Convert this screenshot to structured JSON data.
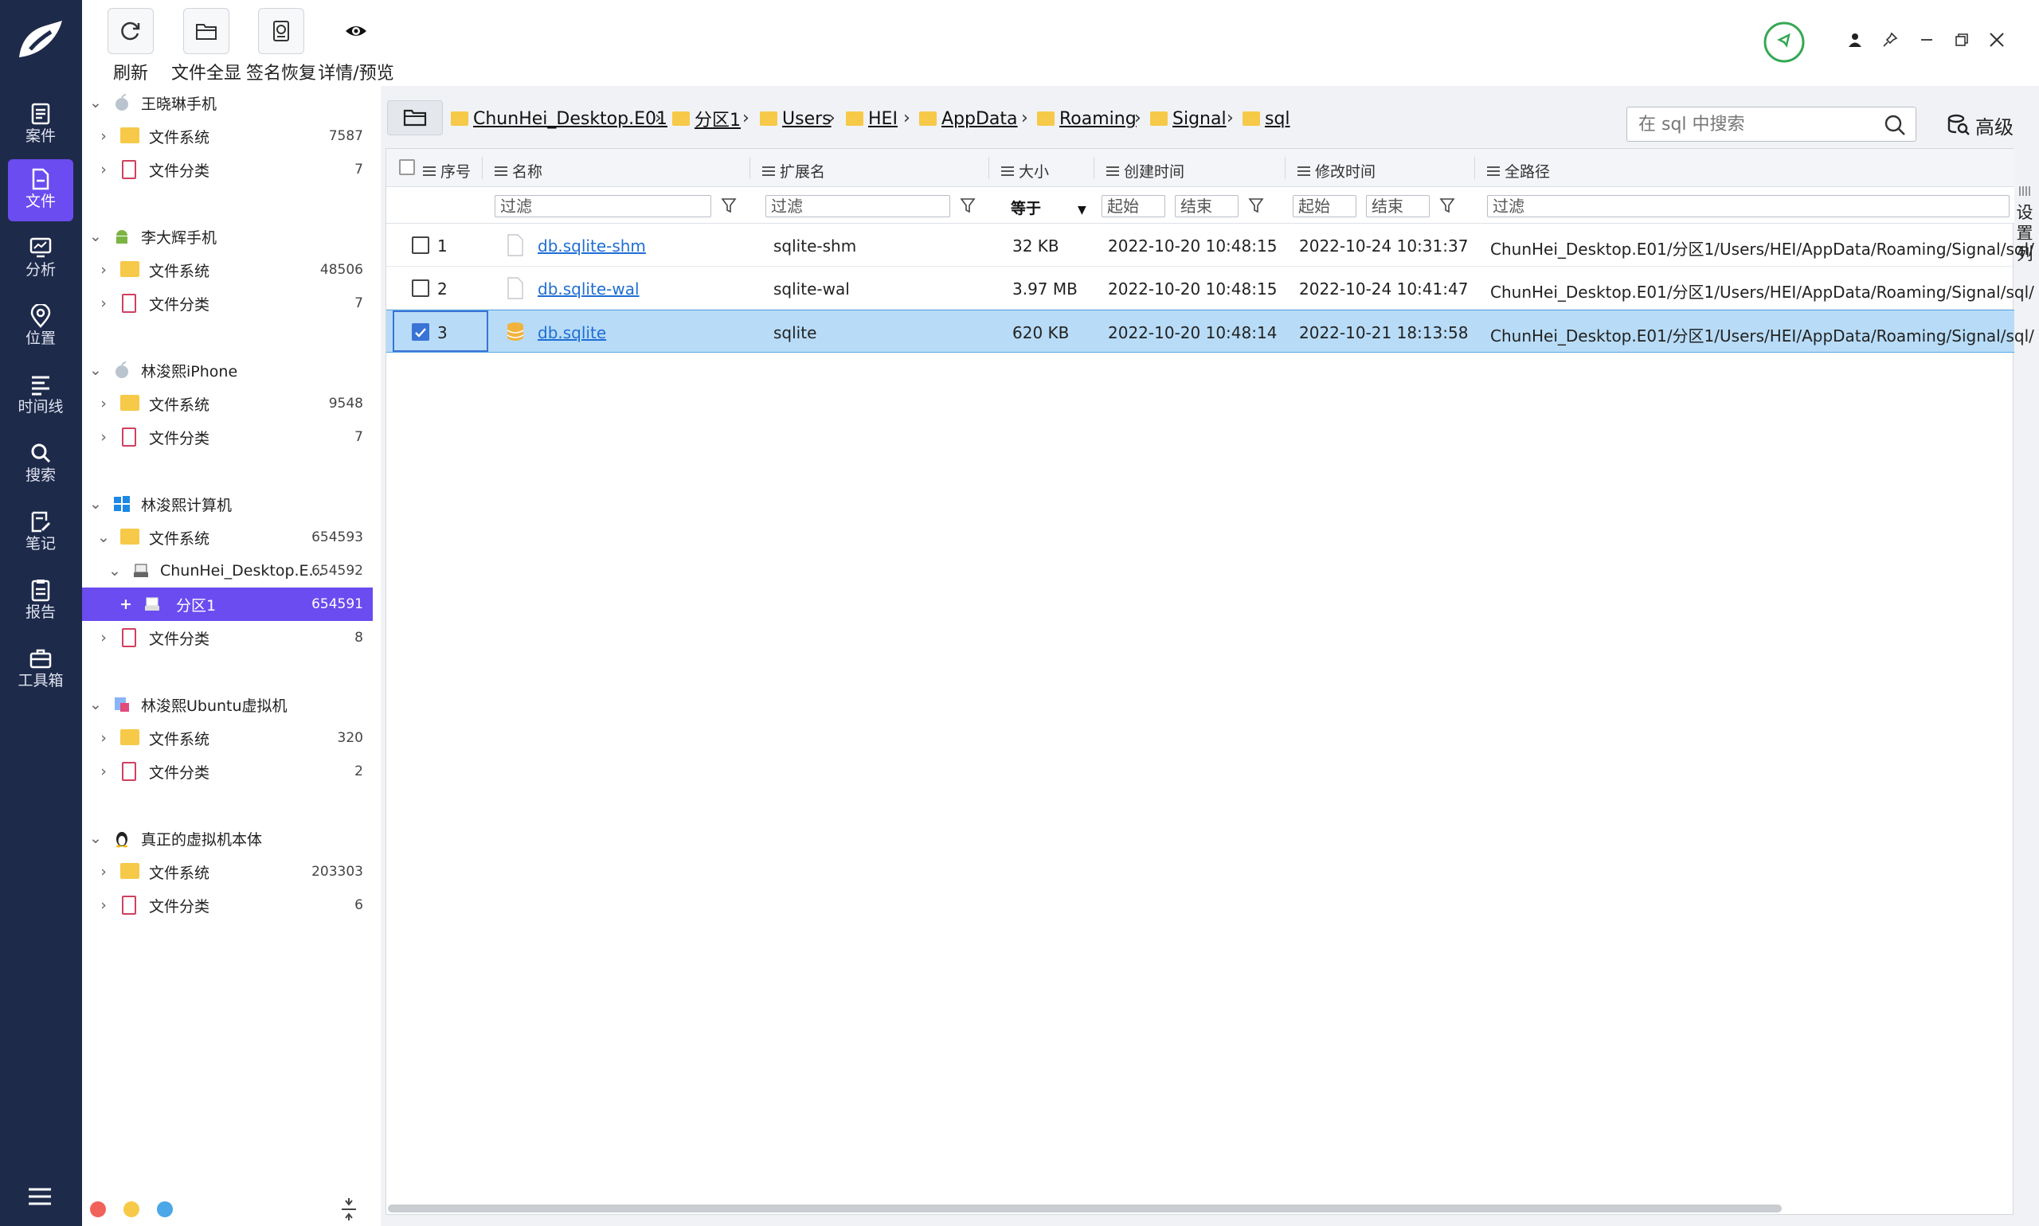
{
  "nav": {
    "items": [
      {
        "label": "案件",
        "icon": "case-icon"
      },
      {
        "label": "文件",
        "icon": "file-icon"
      },
      {
        "label": "分析",
        "icon": "analysis-icon"
      },
      {
        "label": "位置",
        "icon": "location-icon"
      },
      {
        "label": "时间线",
        "icon": "timeline-icon"
      },
      {
        "label": "搜索",
        "icon": "search-icon"
      },
      {
        "label": "笔记",
        "icon": "note-icon"
      },
      {
        "label": "报告",
        "icon": "report-icon"
      },
      {
        "label": "工具箱",
        "icon": "toolbox-icon"
      }
    ],
    "active": "文件"
  },
  "toolbar": {
    "refresh_label": "刷新",
    "show_all_label": "文件全显",
    "signature_label": "签名恢复",
    "detail_label": "详情/预览"
  },
  "tree": {
    "devices": [
      {
        "name": "王晓琳手机",
        "icon": "apple-icon",
        "fs_label": "文件系统",
        "fs_count": "7587",
        "cat_label": "文件分类",
        "cat_count": "7"
      },
      {
        "name": "李大辉手机",
        "icon": "android-icon",
        "fs_label": "文件系统",
        "fs_count": "48506",
        "cat_label": "文件分类",
        "cat_count": "7"
      },
      {
        "name": "林浚熙iPhone",
        "icon": "apple-icon",
        "fs_label": "文件系统",
        "fs_count": "9548",
        "cat_label": "文件分类",
        "cat_count": "7"
      },
      {
        "name": "林浚熙计算机",
        "icon": "windows-icon",
        "fs_label": "文件系统",
        "fs_count": "654593",
        "image_label": "ChunHei_Desktop.E...",
        "image_count": "654592",
        "partition_label": "分区1",
        "partition_count": "654591",
        "cat_label": "文件分类",
        "cat_count": "8"
      },
      {
        "name": "林浚熙Ubuntu虚拟机",
        "icon": "vm-icon",
        "fs_label": "文件系统",
        "fs_count": "320",
        "cat_label": "文件分类",
        "cat_count": "2"
      },
      {
        "name": "真正的虚拟机本体",
        "icon": "linux-icon",
        "fs_label": "文件系统",
        "fs_count": "203303",
        "cat_label": "文件分类",
        "cat_count": "6"
      }
    ]
  },
  "breadcrumb": [
    "ChunHei_Desktop.E01",
    "分区1",
    "Users",
    "HEI",
    "AppData",
    "Roaming",
    "Signal",
    "sql"
  ],
  "search": {
    "placeholder": "在 sql 中搜索"
  },
  "advanced_label": "高级",
  "table": {
    "columns": [
      "序号",
      "名称",
      "扩展名",
      "大小",
      "创建时间",
      "修改时间",
      "全路径"
    ],
    "filters": {
      "name": "过滤",
      "ext": "过滤",
      "size_op": "等于",
      "created_start": "起始",
      "created_end": "结束",
      "modified_start": "起始",
      "modified_end": "结束",
      "path": "过滤"
    },
    "rows": [
      {
        "index": "1",
        "name": "db.sqlite-shm",
        "ext": "sqlite-shm",
        "size": "32 KB",
        "created": "2022-10-20 10:48:15",
        "modified": "2022-10-24 10:31:37",
        "path": "ChunHei_Desktop.E01/分区1/Users/HEI/AppData/Roaming/Signal/sql/",
        "checked": false
      },
      {
        "index": "2",
        "name": "db.sqlite-wal",
        "ext": "sqlite-wal",
        "size": "3.97 MB",
        "created": "2022-10-20 10:48:15",
        "modified": "2022-10-24 10:41:47",
        "path": "ChunHei_Desktop.E01/分区1/Users/HEI/AppData/Roaming/Signal/sql/",
        "checked": false
      },
      {
        "index": "3",
        "name": "db.sqlite",
        "ext": "sqlite",
        "size": "620 KB",
        "created": "2022-10-20 10:48:14",
        "modified": "2022-10-21 18:13:58",
        "path": "ChunHei_Desktop.E01/分区1/Users/HEI/AppData/Roaming/Signal/sql/",
        "checked": true
      }
    ]
  },
  "settings_column_label": "设置列",
  "colors": {
    "rail": "#1e2a4a",
    "accent": "#6a4cf0",
    "selected_row": "#b8dcf7",
    "link": "#1f6ed4",
    "folder": "#f7c948"
  }
}
